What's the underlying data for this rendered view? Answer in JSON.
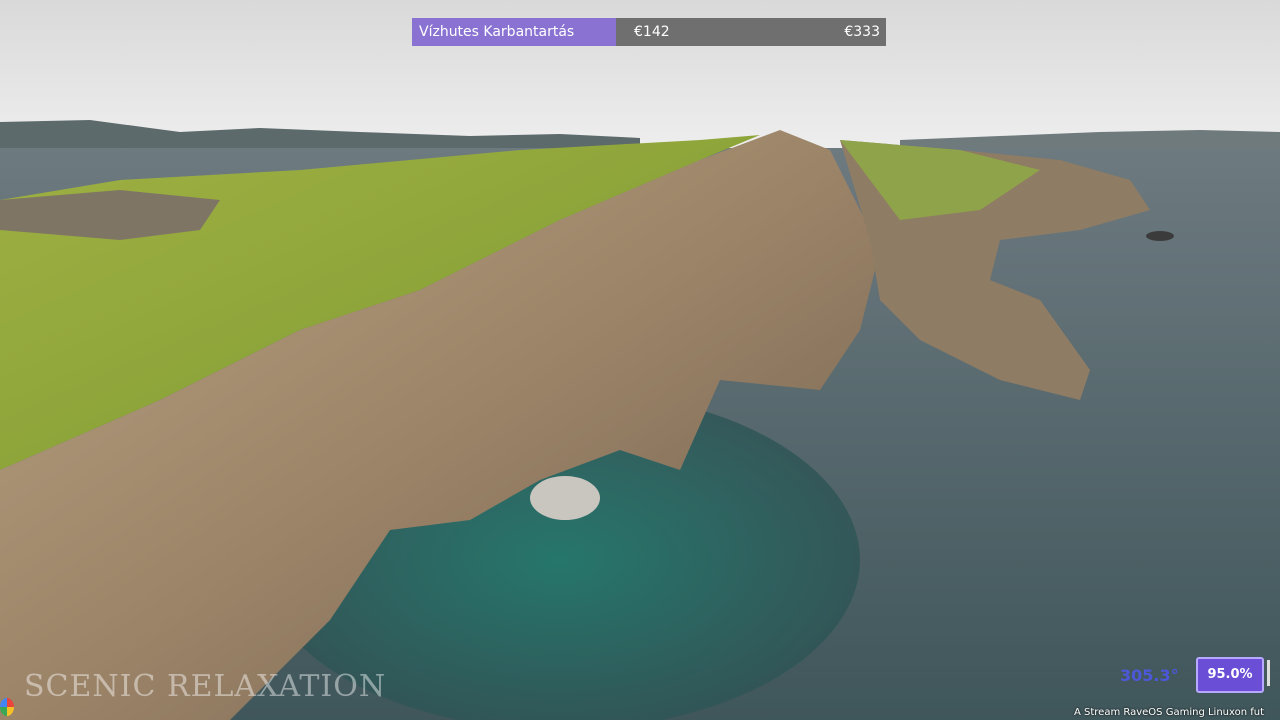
{
  "progress": {
    "label": "Vízhutes Karbantartás",
    "current_value": "€142",
    "max_value": "€333",
    "fill_fraction": 0.43
  },
  "watermark_text": "SCENIC RELAXATION",
  "coordinate_readout": "305.3°",
  "zoom_badge": "95.0%",
  "footer_text": "A Stream RaveOS Gaming Linuxon fut",
  "colors": {
    "progress_fill": "#8a72d2",
    "progress_track": "#6f6f6f",
    "badge_bg": "#6a4fd6",
    "coordinate_text": "#4c58d8"
  },
  "icons": {
    "corner": "app-logo-icon"
  }
}
